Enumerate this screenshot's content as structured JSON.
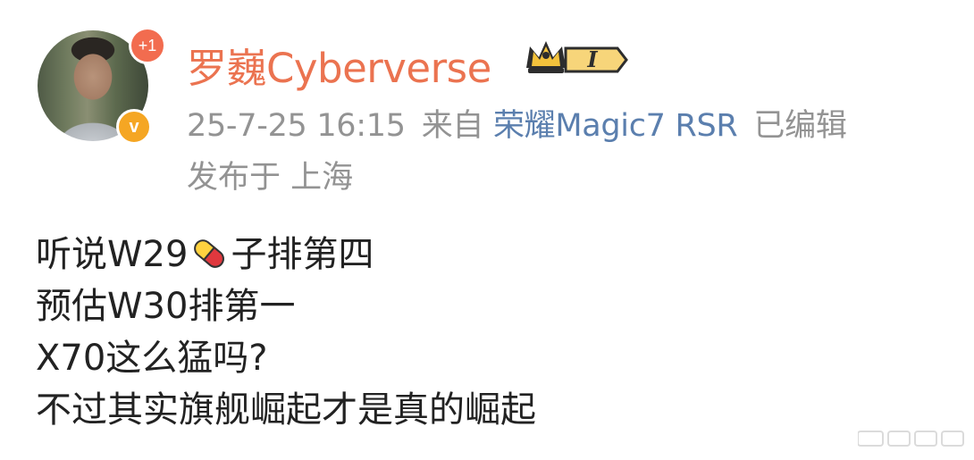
{
  "post": {
    "username": "罗巍Cyberverse",
    "avatar_badge": "+1",
    "verified_mark": "v",
    "member_badge_text": "I",
    "meta": {
      "timestamp": "25-7-25 16:15",
      "source_prefix": "来自",
      "device": "荣耀Magic7 RSR",
      "edited": "已编辑"
    },
    "location": "发布于 上海",
    "content": {
      "line1_a": "听说W29",
      "line1_b": "子排第四",
      "line2": "预估W30排第一",
      "line3": "X70这么猛吗?",
      "line4": "不过其实旗舰崛起才是真的崛起"
    }
  },
  "colors": {
    "username": "#eb7350",
    "meta": "#939393",
    "device_link": "#5b7fae",
    "body_text": "#222222",
    "avatar_plus": "#f26c4f",
    "verified": "#f5a623"
  },
  "icons": {
    "pill": "pill-emoji",
    "crown_badge": "crown-icon"
  }
}
